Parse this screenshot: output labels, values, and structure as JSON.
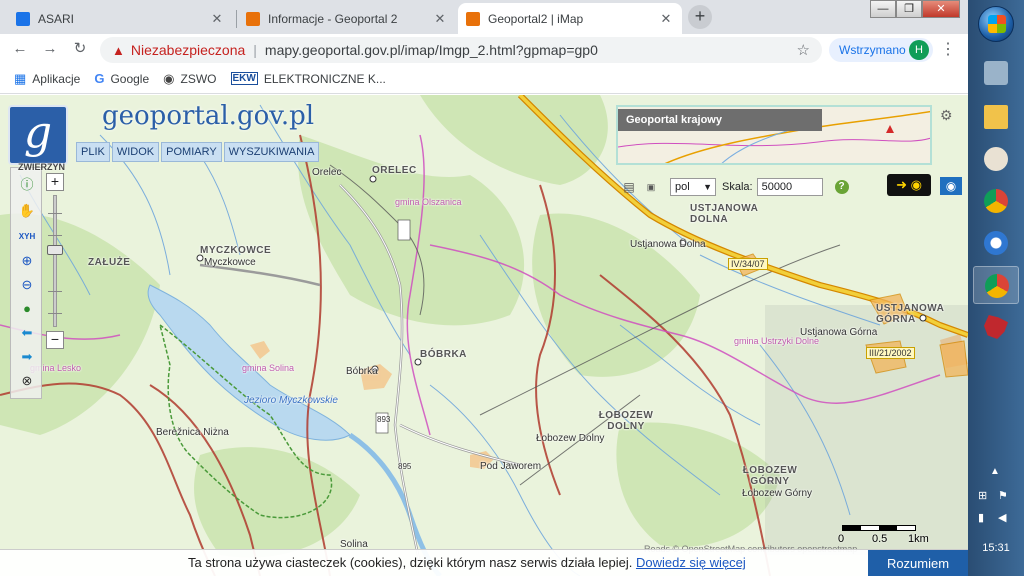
{
  "browser": {
    "tabs": [
      {
        "title": "ASARI",
        "favicon_color": "#1a73e8",
        "active": false
      },
      {
        "title": "Informacje - Geoportal 2",
        "favicon_color": "#e8710a",
        "active": false
      },
      {
        "title": "Geoportal2 | iMap",
        "favicon_color": "#e8710a",
        "active": true
      }
    ],
    "tab_close_glyph": "✕",
    "new_tab_glyph": "+",
    "window": {
      "minimize": "—",
      "maximize": "❐",
      "close": "✕"
    },
    "address": {
      "warning_glyph": "▲",
      "security_label": "Niezabezpieczona",
      "url": "mapy.geoportal.gov.pl/imap/Imgp_2.html?gpmap=gp0"
    },
    "profile": {
      "label": "Wstrzymano",
      "initial": "H",
      "color": "#0f9d58"
    },
    "bookmarks": [
      {
        "label": "Aplikacje",
        "icon": "apps-grid-icon"
      },
      {
        "label": "Google",
        "icon": "google-icon"
      },
      {
        "label": "ZSWO",
        "icon": "globe-icon"
      },
      {
        "label": "ELEKTRONICZNE K...",
        "icon": "ekw-icon"
      }
    ]
  },
  "geoportal": {
    "brand": "geoportal.gov.pl",
    "logo_letter": "g",
    "menu": [
      "PLIK",
      "WIDOK",
      "POMIARY",
      "WYSZUKIWANIA"
    ],
    "zoom_label": "ZWIERZYN",
    "zoom_level_fraction": 0.6,
    "overview_title": "Geoportal krajowy",
    "language": "pol",
    "scale_label": "Skala:",
    "scale_value": "50000",
    "scalebar_labels": [
      "0",
      "0.5",
      "1km"
    ],
    "attribution": "Roads © OpenStreetMap contributors openstreetmap",
    "colors": {
      "brand_blue": "#2b5fa8",
      "menu_bg": "#c9dff2",
      "road_yellow": "#e8b600",
      "admin_border": "#b03a2e",
      "gmina_border": "#d04fc0",
      "forest": "#cfe6b5"
    }
  },
  "map_labels": {
    "places": [
      {
        "name": "ORELEC",
        "type": "place-big"
      },
      {
        "name": "Orelec",
        "type": "place"
      },
      {
        "name": "MYCZKOWCE",
        "type": "place-big"
      },
      {
        "name": "Myczkowce",
        "type": "place"
      },
      {
        "name": "ZAŁUŻE",
        "type": "place-big"
      },
      {
        "name": "USTJANOWA DOLNA",
        "type": "place-big"
      },
      {
        "name": "Ustjanowa Dolna",
        "type": "place"
      },
      {
        "name": "USTJANOWA GÓRNA",
        "type": "place-big"
      },
      {
        "name": "Ustjanowa Górna",
        "type": "place"
      },
      {
        "name": "BÓBRKA",
        "type": "place-big"
      },
      {
        "name": "Bóbrka",
        "type": "place"
      },
      {
        "name": "ŁOBOZEW DOLNY",
        "type": "place-big"
      },
      {
        "name": "Łobozew Dolny",
        "type": "place"
      },
      {
        "name": "ŁOBOZEW GÓRNY",
        "type": "place-big"
      },
      {
        "name": "Łobozew Górny",
        "type": "place"
      },
      {
        "name": "Berežnica Niżna",
        "type": "place"
      },
      {
        "name": "Pod Jaworem",
        "type": "place"
      },
      {
        "name": "Solina",
        "type": "place"
      }
    ],
    "gminy": [
      "gmina Olszanica",
      "gmina Solina",
      "gmina Lesko",
      "gmina Ustrzyki Dolne"
    ],
    "water": [
      "Jezioro Myczkowskie"
    ],
    "roads": [
      "IV/34/07",
      "III/21/2002",
      "895",
      "893"
    ]
  },
  "cookie": {
    "text": "Ta strona używa ciasteczek (cookies), dzięki którym nasz serwis działa lepiej.",
    "link": "Dowiedz się więcej",
    "button": "Rozumiem"
  },
  "taskbar": {
    "clock": "15:31",
    "items": [
      {
        "name": "internet-explorer-taskbar-icon",
        "color": "#3b8ad9"
      },
      {
        "name": "calculator-taskbar-icon",
        "color": "#9ab3c9"
      },
      {
        "name": "folder-taskbar-icon",
        "color": "#f1c24a"
      },
      {
        "name": "paint-taskbar-icon",
        "color": "#e9e1d3"
      },
      {
        "name": "chrome-taskbar-icon",
        "color": "#db4437"
      },
      {
        "name": "thunderbird-taskbar-icon",
        "color": "#2f77d1"
      },
      {
        "name": "chrome-taskbar-icon-2",
        "color": "#db4437"
      },
      {
        "name": "puzzle-taskbar-icon",
        "color": "#c0282e"
      }
    ]
  }
}
